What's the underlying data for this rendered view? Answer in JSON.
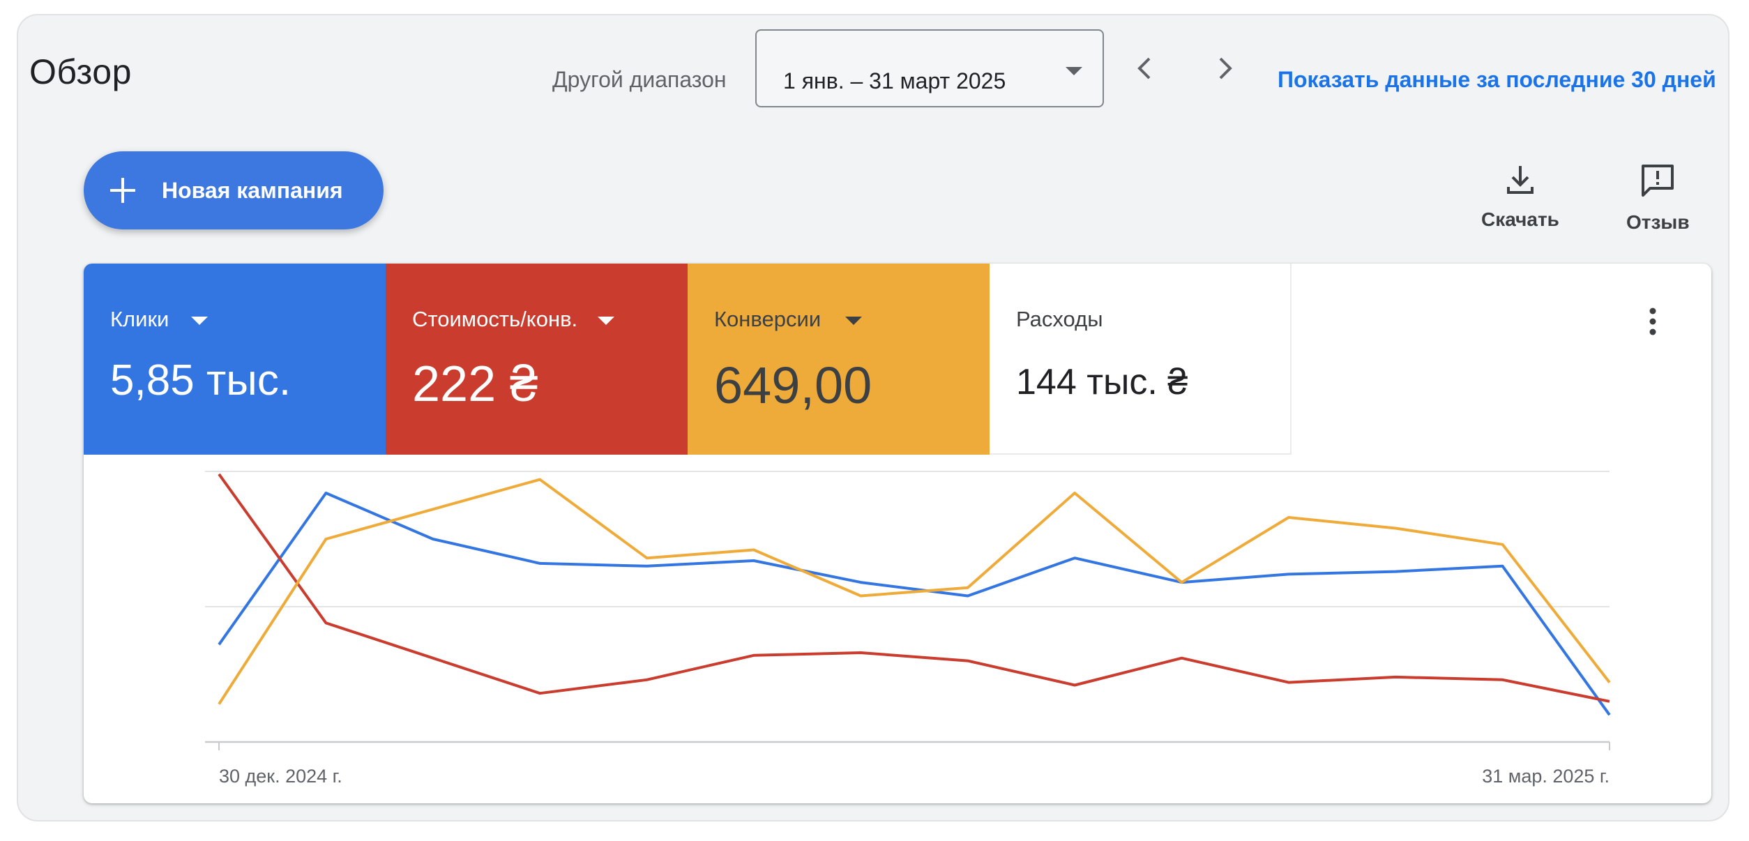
{
  "header": {
    "title": "Обзор",
    "range_label": "Другой диапазон",
    "date_range": "1 янв. – 31 март 2025",
    "last30_link": "Показать данные за последние 30 дней"
  },
  "toolbar": {
    "new_campaign_label": "Новая кампания",
    "download_label": "Скачать",
    "feedback_label": "Отзыв"
  },
  "metrics": [
    {
      "label": "Клики",
      "value": "5,85 тыс.",
      "color": "#3476e1"
    },
    {
      "label": "Стоимость/конв.",
      "value": "222 ₴",
      "color": "#c93c2e"
    },
    {
      "label": "Конверсии",
      "value": "649,00",
      "color": "#efab3a"
    },
    {
      "label": "Расходы",
      "value": "144 тыс. ₴",
      "color": "#ffffff"
    }
  ],
  "chart_data": {
    "type": "line",
    "x_tick_labels": [
      "30 дек. 2024 г.",
      "31 мар. 2025 г."
    ],
    "y_range": [
      0,
      100
    ],
    "grid": true,
    "legend": "none",
    "series": [
      {
        "name": "Клики",
        "color": "#3476e1",
        "values": [
          36,
          92,
          75,
          66,
          65,
          67,
          59,
          54,
          68,
          59,
          62,
          63,
          65,
          10
        ]
      },
      {
        "name": "Стоимость/конв.",
        "color": "#c93c2e",
        "values": [
          99,
          44,
          31,
          18,
          23,
          32,
          33,
          30,
          21,
          31,
          22,
          24,
          23,
          15
        ]
      },
      {
        "name": "Конверсии",
        "color": "#efab3a",
        "values": [
          14,
          75,
          86,
          97,
          68,
          71,
          54,
          57,
          92,
          59,
          83,
          79,
          73,
          22
        ]
      }
    ]
  }
}
